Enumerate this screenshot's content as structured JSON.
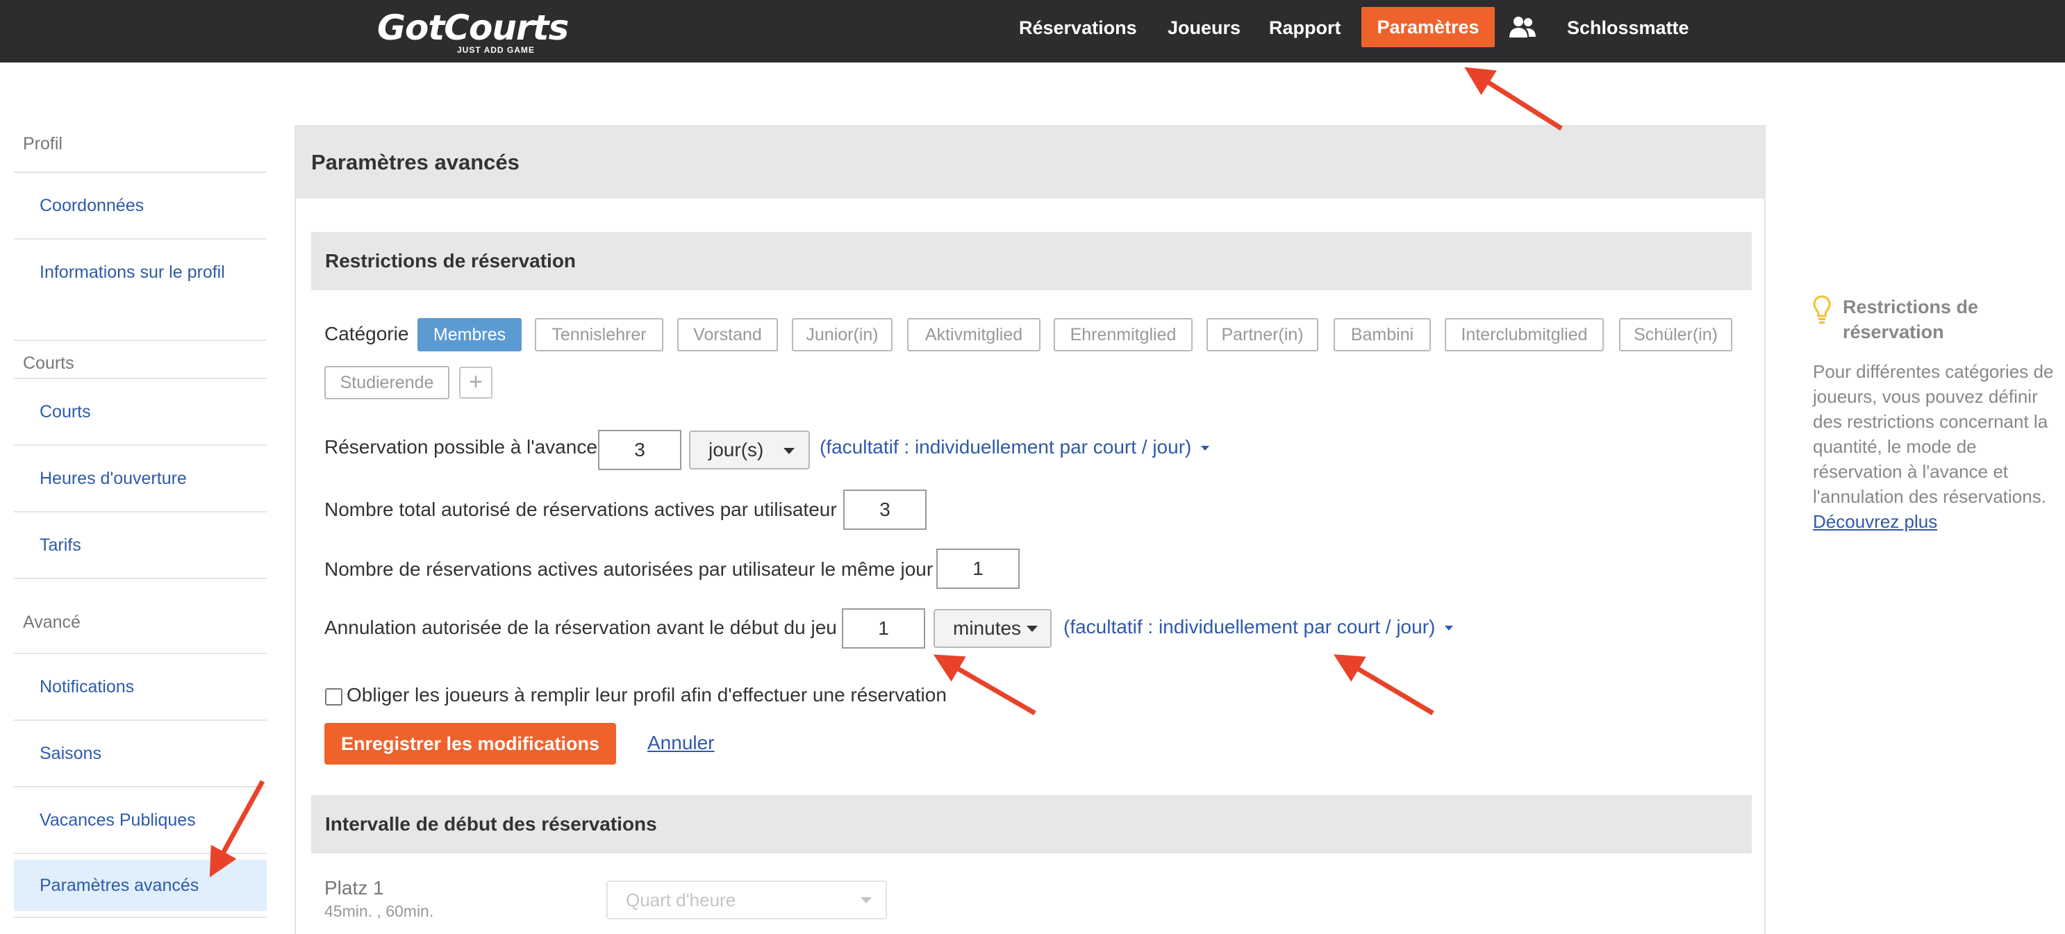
{
  "nav": {
    "logo": "GotCourts",
    "logo_tagline": "JUST ADD GAME",
    "items": [
      "Réservations",
      "Joueurs",
      "Rapport"
    ],
    "active": "Paramètres",
    "user_icon": "users-icon",
    "club": "Schlossmatte"
  },
  "sidebar": {
    "groups": [
      {
        "heading": "Profil",
        "items": [
          "Coordonnées",
          "Informations sur le profil"
        ]
      },
      {
        "heading": "Courts",
        "items": [
          "Courts",
          "Heures d'ouverture",
          "Tarifs"
        ]
      },
      {
        "heading": "Avancé",
        "items": [
          "Notifications",
          "Saisons",
          "Vacances Publiques",
          "Paramètres avancés"
        ]
      }
    ],
    "active_item": "Paramètres avancés"
  },
  "main": {
    "title": "Paramètres avancés",
    "restrictions": {
      "heading": "Restrictions de réservation",
      "category_label": "Catégorie",
      "categories": [
        "Membres",
        "Tennislehrer",
        "Vorstand",
        "Junior(in)",
        "Aktivmitglied",
        "Ehrenmitglied",
        "Partner(in)",
        "Bambini",
        "Interclubmitglied",
        "Schüler(in)",
        "Studierende"
      ],
      "active_category": "Membres",
      "add_icon": "plus-icon",
      "advance": {
        "label": "Réservation possible à l'avance :",
        "value": "3",
        "unit": "jour(s)",
        "optional": "(facultatif : individuellement par court / jour)"
      },
      "total_active": {
        "label": "Nombre total autorisé de réservations actives par utilisateur :",
        "value": "3"
      },
      "same_day": {
        "label": "Nombre de réservations actives autorisées par utilisateur le même jour :",
        "value": "1"
      },
      "cancellation": {
        "label": "Annulation autorisée de la réservation avant le début du jeu :",
        "value": "1",
        "unit": "minutes",
        "optional": "(facultatif : individuellement par court / jour)"
      },
      "profile_required": {
        "label": "Obliger les joueurs à remplir leur profil afin d'effectuer une réservation",
        "checked": false
      },
      "save": "Enregistrer les modifications",
      "cancel": "Annuler"
    },
    "interval": {
      "heading": "Intervalle de début des réservations",
      "courts": [
        {
          "name": "Platz 1",
          "durations": "45min. , 60min.",
          "placeholder": "Quart d'heure"
        }
      ]
    }
  },
  "help": {
    "icon": "lightbulb-icon",
    "title": "Restrictions de réservation",
    "text": "Pour différentes catégories de joueurs, vous pouvez définir des restrictions concernant la quantité, le mode de réservation à l'avance et l'annulation des réservations.",
    "link": "Découvrez plus"
  },
  "colors": {
    "topbar": "#2d2d2f",
    "accent": "#f0622c",
    "link": "#2f5aa8",
    "chip_active": "#5b9bd1",
    "annotation_arrow": "#e8432a"
  }
}
